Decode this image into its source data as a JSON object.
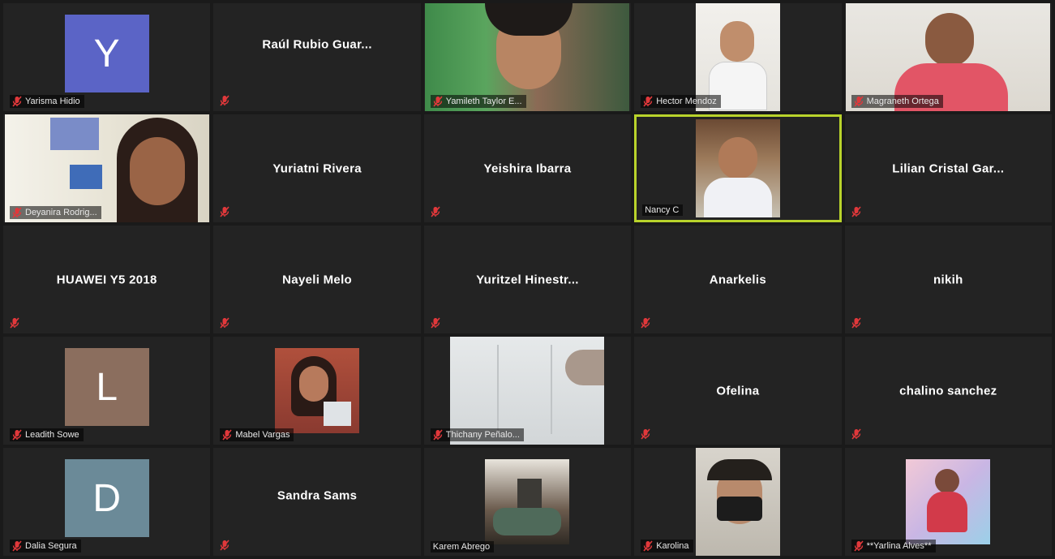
{
  "colors": {
    "tile_bg": "#232323",
    "active_border": "#b9d32b",
    "mute_icon": "#e0383b",
    "avatar_y": "#5b64c6",
    "avatar_l": "#8b6e5e",
    "avatar_d": "#6b8a98"
  },
  "participants": [
    {
      "name": "Yarisma Hidio",
      "kind": "avatar",
      "initial": "Y",
      "muted": true
    },
    {
      "name": "Raúl Rubio Guar...",
      "kind": "name",
      "muted": true
    },
    {
      "name": "Yamileth Taylor E...",
      "kind": "video",
      "muted": true
    },
    {
      "name": "Hector Mendoz",
      "kind": "video",
      "muted": true
    },
    {
      "name": "Magraneth Ortega",
      "kind": "video",
      "muted": true
    },
    {
      "name": "Deyanira Rodrig...",
      "kind": "video",
      "muted": true
    },
    {
      "name": "Yuriatni Rivera",
      "kind": "name",
      "muted": true
    },
    {
      "name": "Yeishira Ibarra",
      "kind": "name",
      "muted": true
    },
    {
      "name": "Nancy C",
      "kind": "video",
      "muted": false,
      "active_speaker": true
    },
    {
      "name": "Lilian Cristal Gar...",
      "kind": "name",
      "muted": true
    },
    {
      "name": "HUAWEI Y5 2018",
      "kind": "name",
      "muted": true
    },
    {
      "name": "Nayeli Melo",
      "kind": "name",
      "muted": true
    },
    {
      "name": "Yuritzel Hinestr...",
      "kind": "name",
      "muted": true
    },
    {
      "name": "Anarkelis",
      "kind": "name",
      "muted": true
    },
    {
      "name": "nikih",
      "kind": "name",
      "muted": true
    },
    {
      "name": "Leadith Sowe",
      "kind": "avatar",
      "initial": "L",
      "muted": true
    },
    {
      "name": "Mabel Vargas",
      "kind": "video",
      "muted": true
    },
    {
      "name": "Thichany Peñalo...",
      "kind": "video",
      "muted": true
    },
    {
      "name": "Ofelina",
      "kind": "name",
      "muted": true
    },
    {
      "name": "chalino sanchez",
      "kind": "name",
      "muted": true
    },
    {
      "name": "Dalia Segura",
      "kind": "avatar",
      "initial": "D",
      "muted": true
    },
    {
      "name": "Sandra Sams",
      "kind": "name",
      "muted": true
    },
    {
      "name": "Karem Abrego",
      "kind": "video",
      "muted": false
    },
    {
      "name": "Karolina",
      "kind": "video",
      "muted": true
    },
    {
      "name": "**Yarlina Alves**",
      "kind": "video",
      "muted": true
    }
  ]
}
